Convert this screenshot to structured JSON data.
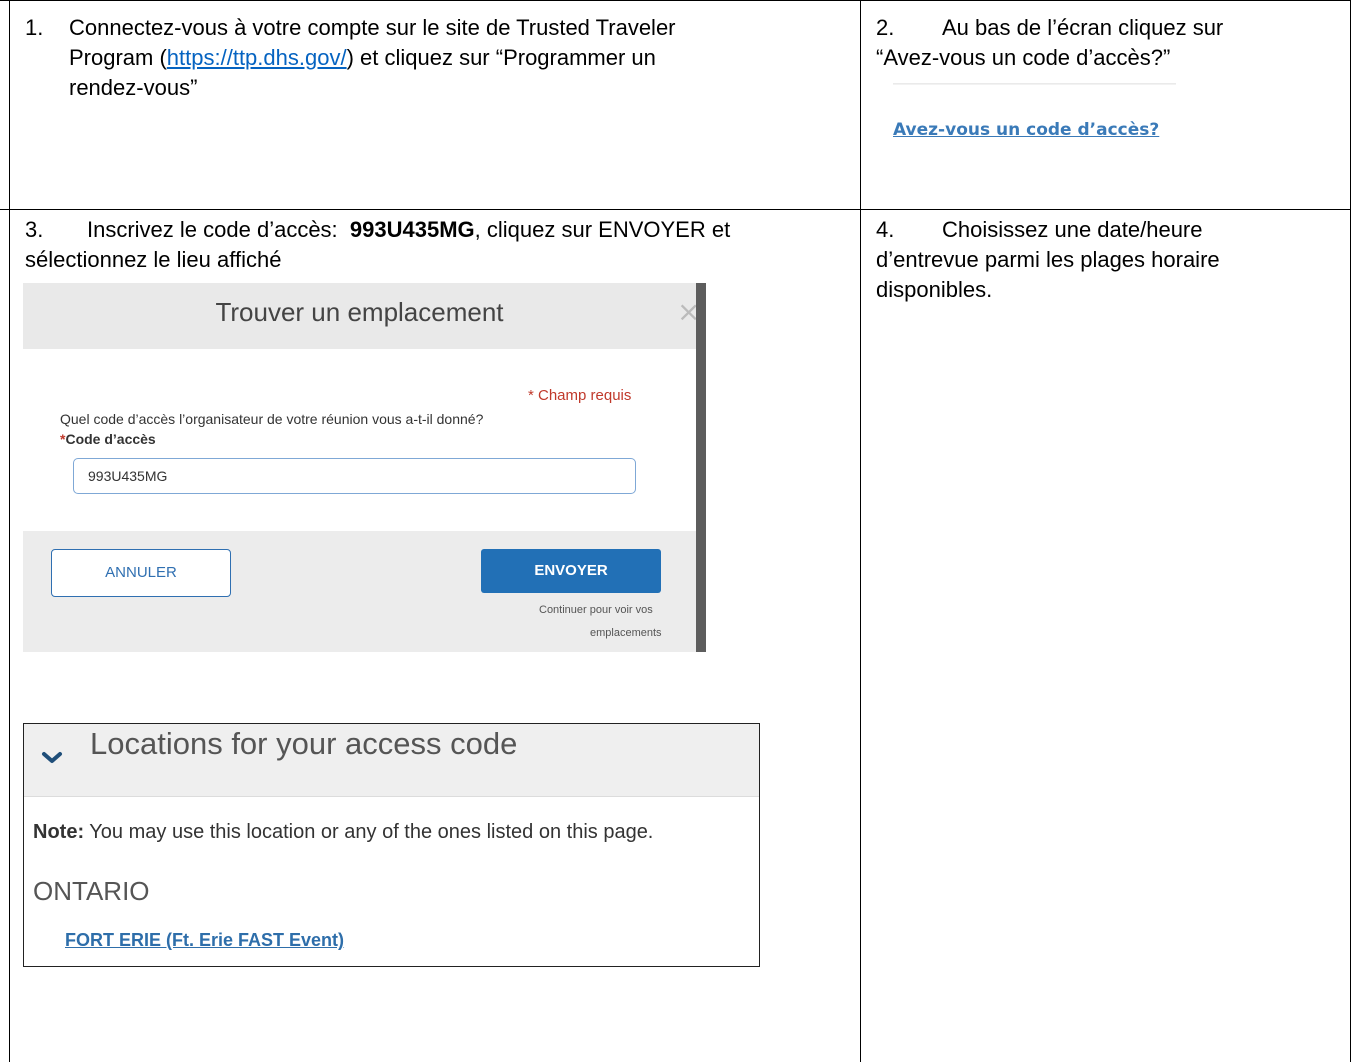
{
  "cells": {
    "step1": {
      "number": "1.",
      "line1": "Connectez-vous à votre compte sur le site de Trusted Traveler",
      "line2_before": "Program (",
      "url": "https://ttp.dhs.gov/",
      "line2_after": ") et cliquez sur “Programmer un",
      "line3": "rendez-vous”"
    },
    "step2": {
      "number": "2.",
      "line1": "Au bas de l’écran cliquez sur",
      "line2": "“Avez-vous un code d’accès?”",
      "link": "Avez-vous un code d’accès?"
    },
    "step3": {
      "number": "3.",
      "line1_before": "Inscrivez le code d’accès:",
      "code": "993U435MG",
      "line1_after": ", cliquez sur ENVOYER et",
      "line2": "sélectionnez le lieu affiché"
    },
    "step4": {
      "number": "4.",
      "line1": "Choisissez une date/heure",
      "line2": "d’entrevue parmi les plages horaire",
      "line3": "disponibles."
    }
  },
  "dialog": {
    "title": "Trouver un emplacement",
    "close_icon": "×",
    "required_note": "* Champ requis",
    "question": "Quel code d’accès l’organisateur de votre réunion vous a-t-il donné?",
    "field_star": "*",
    "field_label": "Code d’accès",
    "field_value": "993U435MG",
    "cancel_label": "ANNULER",
    "submit_label": "ENVOYER",
    "continue_line1": "Continuer pour voir vos",
    "continue_line2": "emplacements"
  },
  "locations": {
    "title": "Locations for your access code",
    "note_label": "Note:",
    "note_text": " You may use this location or any of the ones listed on this page.",
    "province": "ONTARIO",
    "location_link": "FORT ERIE (Ft. Erie FAST Event)"
  }
}
